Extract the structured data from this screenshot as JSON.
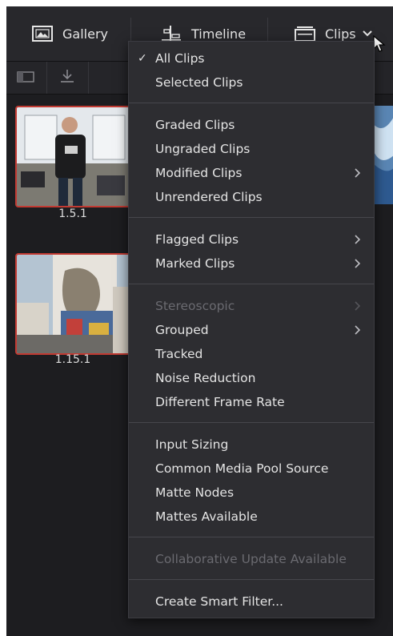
{
  "toolbar": {
    "gallery_label": "Gallery",
    "timeline_label": "Timeline",
    "clips_label": "Clips"
  },
  "thumbnails": [
    {
      "label": "1.5.1",
      "selected": true
    },
    {
      "label": "1.15.1",
      "selected": true
    }
  ],
  "menu": {
    "checked_item": "All Clips",
    "groups": [
      [
        {
          "label": "All Clips",
          "checked": true
        },
        {
          "label": "Selected Clips"
        }
      ],
      [
        {
          "label": "Graded Clips"
        },
        {
          "label": "Ungraded Clips"
        },
        {
          "label": "Modified Clips",
          "submenu": true
        },
        {
          "label": "Unrendered Clips"
        }
      ],
      [
        {
          "label": "Flagged Clips",
          "submenu": true
        },
        {
          "label": "Marked Clips",
          "submenu": true
        }
      ],
      [
        {
          "label": "Stereoscopic",
          "submenu": true,
          "disabled": true
        },
        {
          "label": "Grouped",
          "submenu": true
        },
        {
          "label": "Tracked"
        },
        {
          "label": "Noise Reduction"
        },
        {
          "label": "Different Frame Rate"
        }
      ],
      [
        {
          "label": "Input Sizing"
        },
        {
          "label": "Common Media Pool Source"
        },
        {
          "label": "Matte Nodes"
        },
        {
          "label": "Mattes Available"
        }
      ],
      [
        {
          "label": "Collaborative Update Available",
          "disabled": true
        }
      ],
      [
        {
          "label": "Create Smart Filter..."
        }
      ]
    ]
  },
  "colors": {
    "selection_border": "#c23a32",
    "menu_bg": "#2d2d31",
    "disabled_text": "#6a6a70"
  }
}
